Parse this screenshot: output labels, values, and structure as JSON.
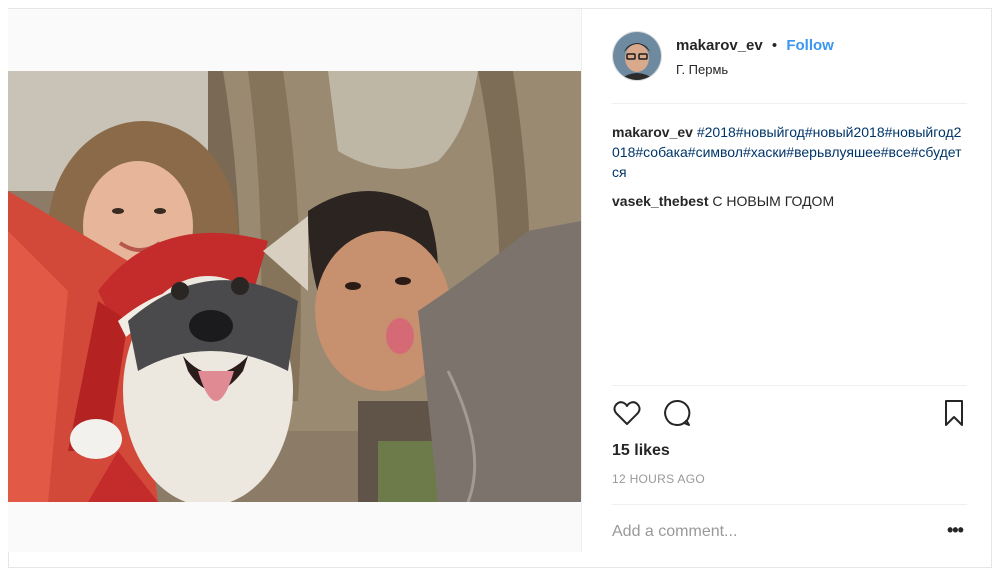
{
  "post": {
    "username": "makarov_ev",
    "separator": "•",
    "follow_label": "Follow",
    "location": "Г. Пермь"
  },
  "comments": [
    {
      "username": "makarov_ev",
      "hashtags": "#2018#новыйгод#новый2018#новыйгод2018#собака#символ#хаски#верьвлуяшее#все#сбудется",
      "text": ""
    },
    {
      "username": "vasek_thebest",
      "hashtags": "",
      "text": "С НОВЫМ ГОДОМ"
    }
  ],
  "actions": {
    "like_icon": "heart-outline-icon",
    "comment_icon": "speech-bubble-icon",
    "save_icon": "bookmark-icon"
  },
  "likes_text": "15 likes",
  "timestamp": "12 HOURS AGO",
  "add_comment_placeholder": "Add a comment...",
  "more_options_label": "•••",
  "colors": {
    "link": "#3897f0",
    "hashtag": "#003569",
    "muted": "#999999",
    "text": "#262626"
  }
}
